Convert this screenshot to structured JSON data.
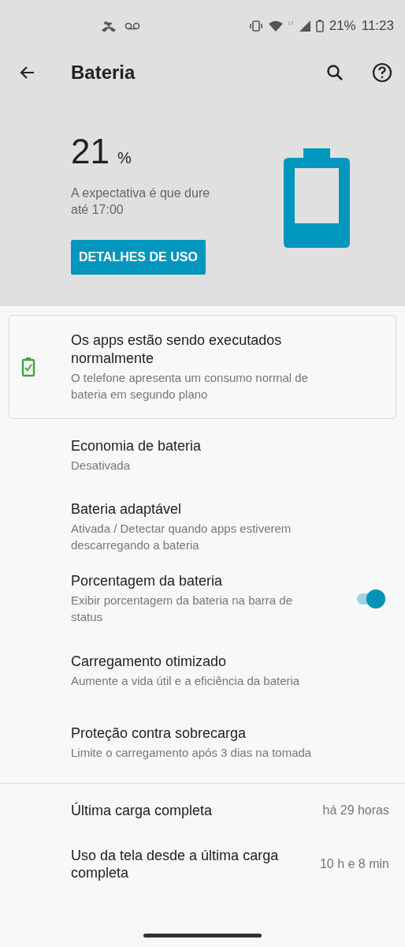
{
  "status_bar": {
    "battery": "21%",
    "time": "11:23"
  },
  "toolbar": {
    "title": "Bateria"
  },
  "header": {
    "percent": "21",
    "unit": "%",
    "estimate": "A expectativa é que dure até 17:00",
    "button": "DETALHES DE USO"
  },
  "status_card": {
    "title": "Os apps estão sendo executados normalmente",
    "subtitle": "O telefone apresenta um consumo normal de bateria em segundo plano"
  },
  "settings": [
    {
      "kind": "text",
      "title": "Economia de bateria",
      "subtitle": "Desativada"
    },
    {
      "kind": "text",
      "title": "Bateria adaptável",
      "subtitle": "Ativada / Detectar quando apps estiverem descarregando a bateria"
    },
    {
      "kind": "switch",
      "title": "Porcentagem da bateria",
      "subtitle": "Exibir porcentagem da bateria na barra de status",
      "on": true
    },
    {
      "kind": "text",
      "title": "Carregamento otimizado",
      "subtitle": "Aumente a vida útil e a eficiência da bateria"
    },
    {
      "kind": "text",
      "title": "Proteção contra sobrecarga",
      "subtitle": "Limite o carregamento após 3 dias na tomada"
    }
  ],
  "info_rows": [
    {
      "label": "Última carga completa",
      "value": "há 29 horas"
    },
    {
      "label": "Uso da tela desde a última carga completa",
      "value": "10 h e 8 min"
    }
  ]
}
